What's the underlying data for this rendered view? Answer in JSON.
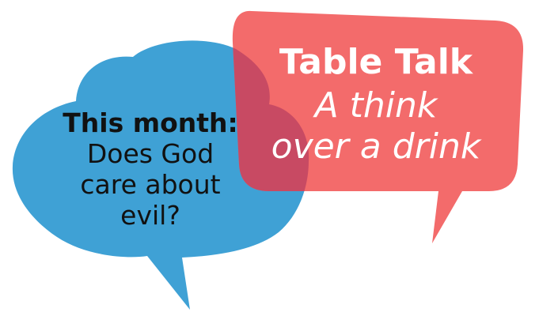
{
  "left_bubble": {
    "color": "#3fa1d5",
    "heading": "This month:",
    "lines": [
      "Does God",
      "care about",
      "evil?"
    ]
  },
  "right_bubble": {
    "color": "#f36b6b",
    "overlap_color": "#c84a63",
    "title": "Table Talk",
    "tagline_lines": [
      "A think",
      "over a drink"
    ]
  }
}
